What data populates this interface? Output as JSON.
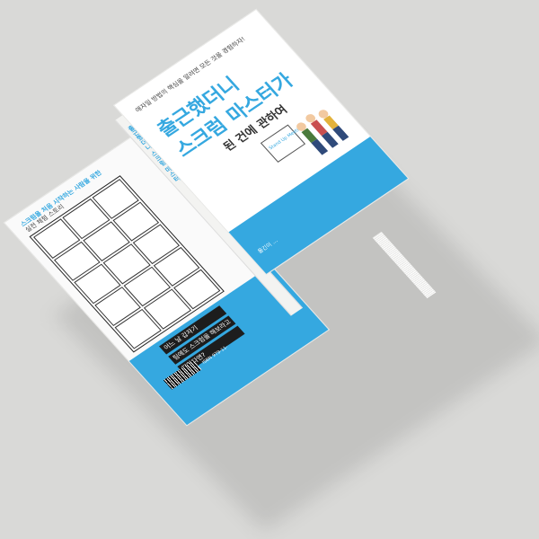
{
  "front_cover": {
    "tagline": "애자일 방법의 핵심을 알려면 모든 것을 경험하자!",
    "title_line1": "출근했더니",
    "title_line2": "스크럼 마스터가",
    "title_line3": "된 건에 관하여",
    "author": "옮긴이 …",
    "whiteboard_text": "Stand Up Meeting"
  },
  "spine": {
    "label": "출근했더니 스크럼 마스터"
  },
  "back_cover": {
    "story_line1": "스크럼을 처음 시작하는 사람을 위한",
    "story_line2": "실전 체험 스토리",
    "quote1": "어느 날 갑자기",
    "quote2": "팀에도 스크럼을 해보라고",
    "quote3": "말한다면?",
    "isbn": "ISBN 979-11-"
  },
  "colors": {
    "accent": "#35a8e0",
    "background": "#d9d9d7"
  }
}
